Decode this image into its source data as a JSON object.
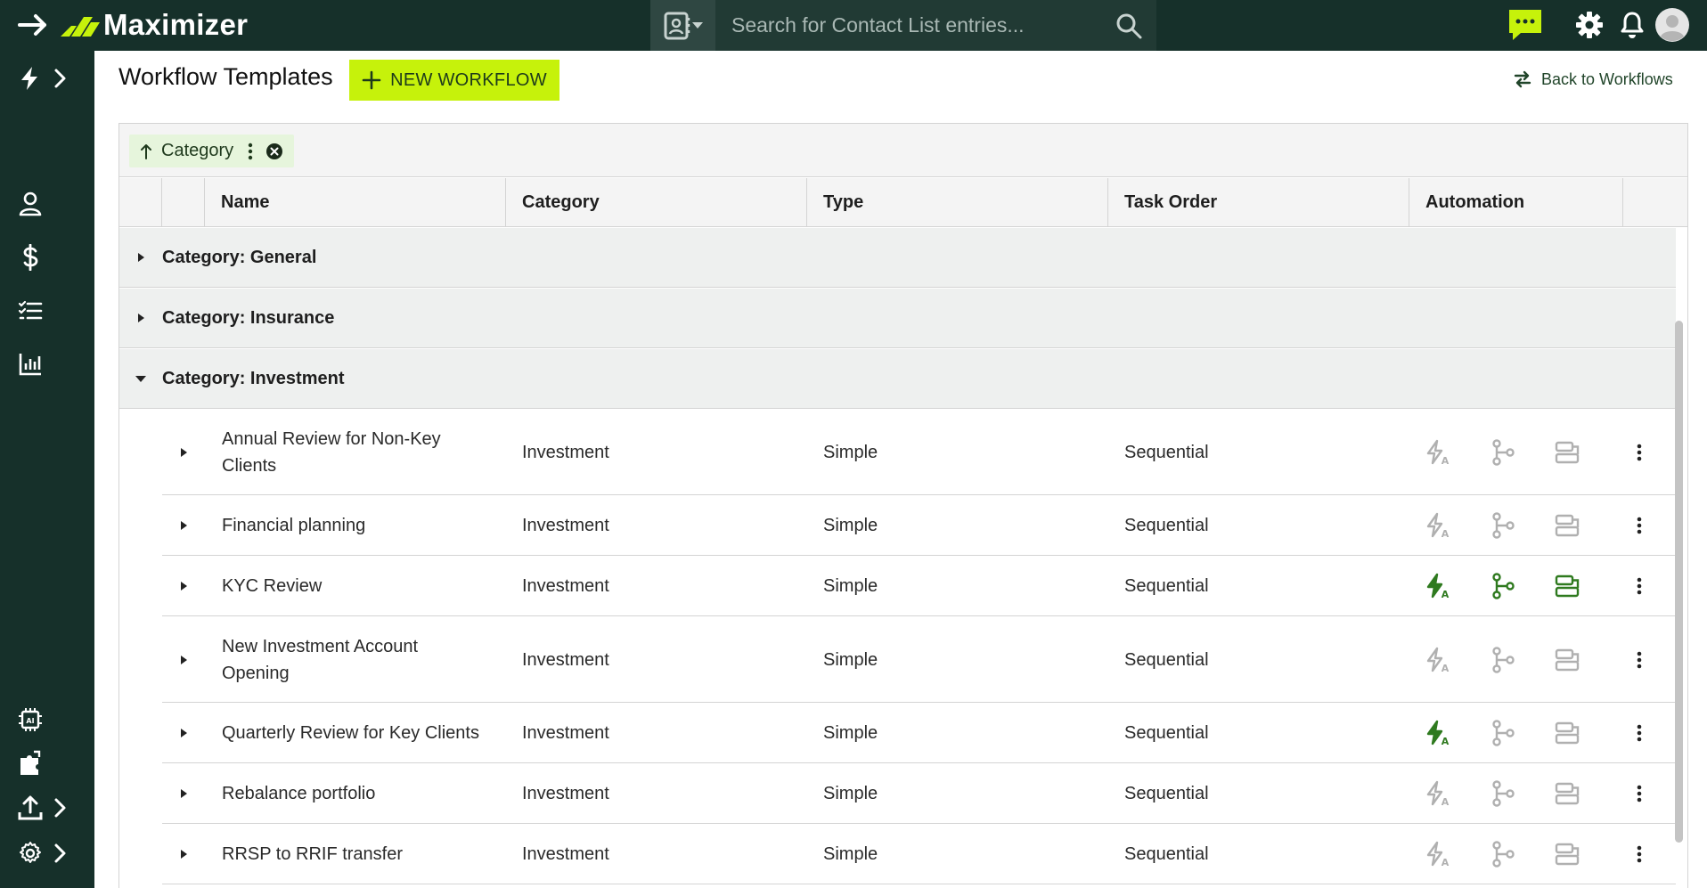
{
  "header": {
    "logo_text": "Maximizer",
    "search_placeholder": "Search for Contact List entries..."
  },
  "page": {
    "title": "Workflow Templates",
    "new_button_label": "NEW WORKFLOW",
    "back_link_label": "Back to Workflows"
  },
  "grouping": {
    "chip_label": "Category"
  },
  "columns": {
    "name": "Name",
    "category": "Category",
    "type": "Type",
    "task_order": "Task Order",
    "automation": "Automation"
  },
  "groups": [
    {
      "label": "Category: General",
      "expanded": false
    },
    {
      "label": "Category: Insurance",
      "expanded": false
    },
    {
      "label": "Category: Investment",
      "expanded": true
    }
  ],
  "rows": [
    {
      "name": "Annual Review for Non-Key Clients",
      "category": "Investment",
      "type": "Simple",
      "task_order": "Sequential",
      "automation": {
        "trigger": false,
        "branch": false,
        "action": false
      }
    },
    {
      "name": "Financial planning",
      "category": "Investment",
      "type": "Simple",
      "task_order": "Sequential",
      "automation": {
        "trigger": false,
        "branch": false,
        "action": false
      }
    },
    {
      "name": "KYC Review",
      "category": "Investment",
      "type": "Simple",
      "task_order": "Sequential",
      "automation": {
        "trigger": true,
        "branch": true,
        "action": true
      }
    },
    {
      "name": "New Investment Account Opening",
      "category": "Investment",
      "type": "Simple",
      "task_order": "Sequential",
      "automation": {
        "trigger": false,
        "branch": false,
        "action": false
      }
    },
    {
      "name": "Quarterly Review for Key Clients",
      "category": "Investment",
      "type": "Simple",
      "task_order": "Sequential",
      "automation": {
        "trigger": true,
        "branch": false,
        "action": false
      }
    },
    {
      "name": "Rebalance portfolio",
      "category": "Investment",
      "type": "Simple",
      "task_order": "Sequential",
      "automation": {
        "trigger": false,
        "branch": false,
        "action": false
      }
    },
    {
      "name": "RRSP to RRIF transfer",
      "category": "Investment",
      "type": "Simple",
      "task_order": "Sequential",
      "automation": {
        "trigger": false,
        "branch": false,
        "action": false
      }
    }
  ],
  "colors": {
    "topbar": "#16302a",
    "accent": "#c6f20b",
    "chat": "#c6f20b",
    "active_icon": "#2f7a1f",
    "inactive_icon": "#b0b0b0"
  }
}
